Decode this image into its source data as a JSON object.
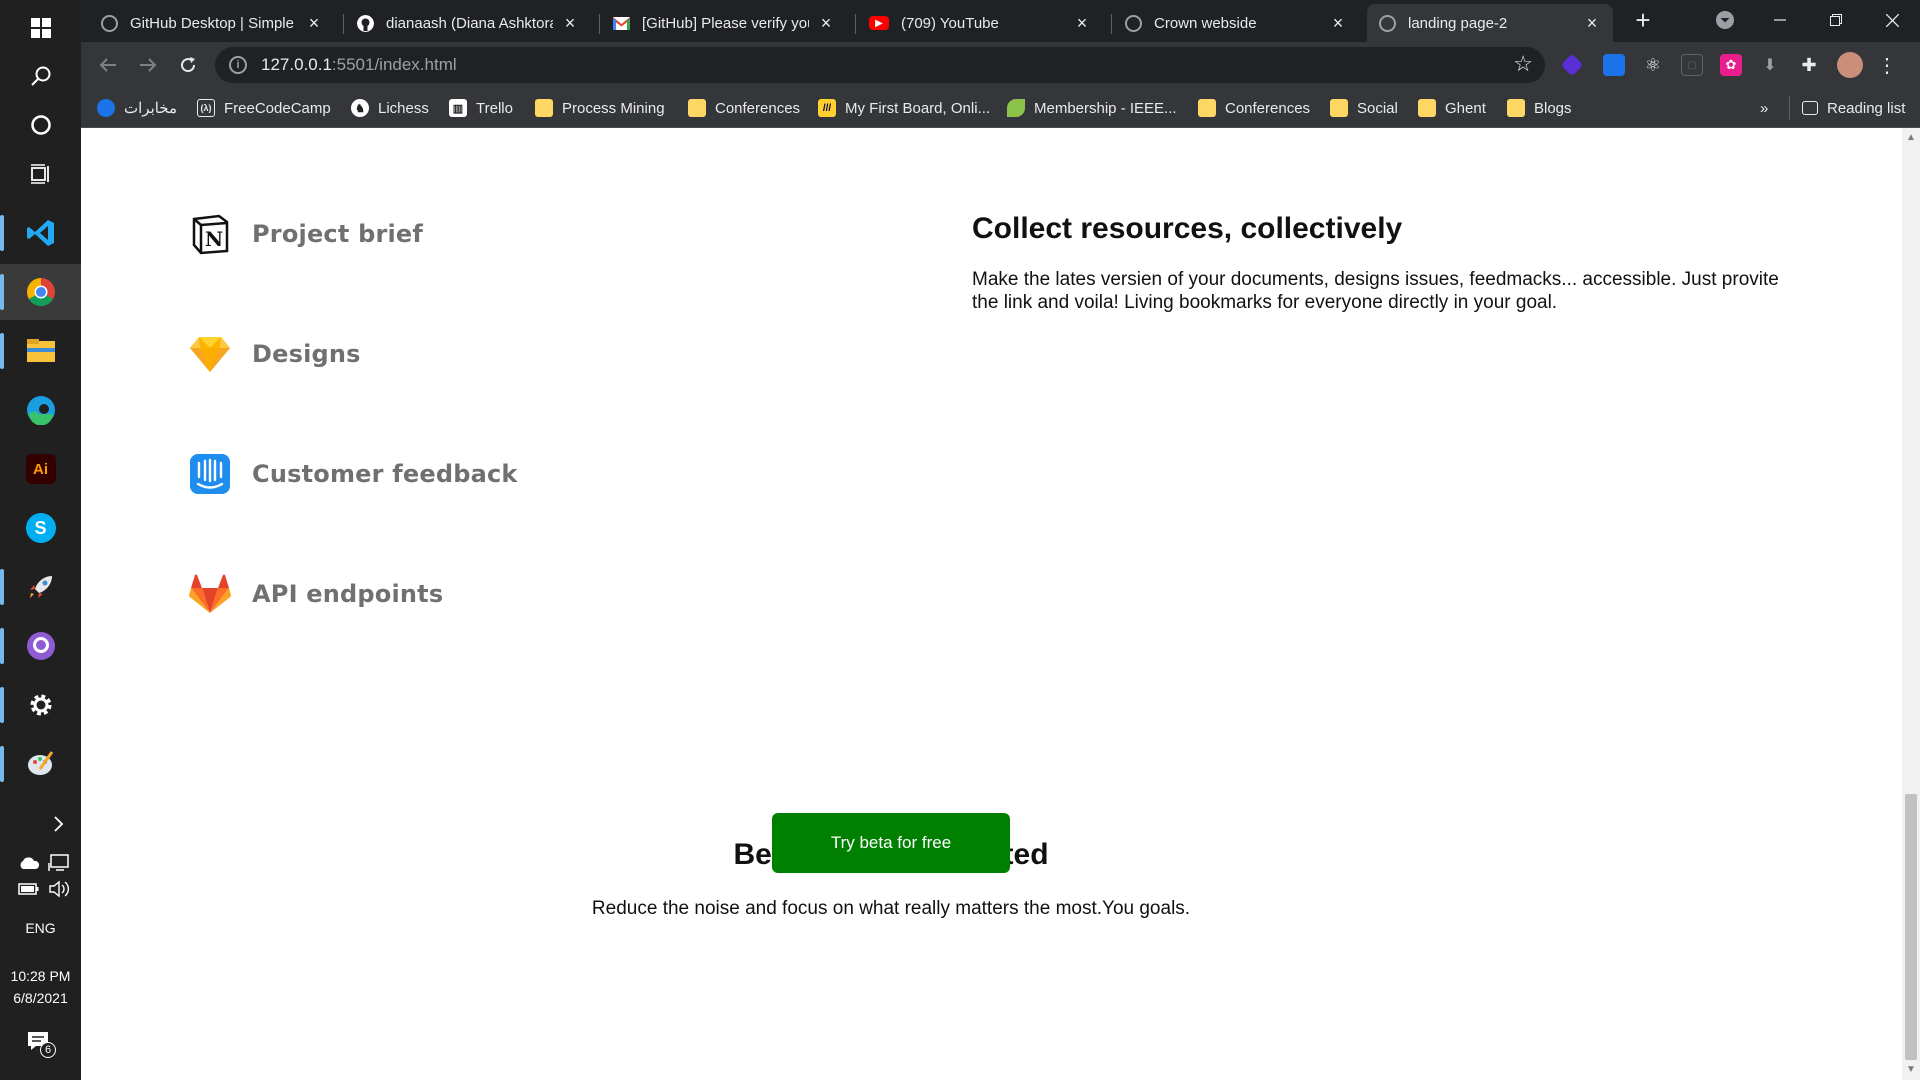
{
  "taskbar": {
    "keyboard_lang": "ENG",
    "time": "10:28 PM",
    "date": "6/8/2021",
    "notification_count": "6",
    "ai_app_label": "Ai",
    "skype_label": "S"
  },
  "browser": {
    "tabs": [
      {
        "title": "GitHub Desktop | Simple c"
      },
      {
        "title": "dianaash (Diana Ashktorab"
      },
      {
        "title": "[GitHub] Please verify you"
      },
      {
        "title": "(709) YouTube"
      },
      {
        "title": "Crown webside"
      },
      {
        "title": "landing page-2"
      }
    ],
    "address": {
      "host": "127.0.0.1",
      "path": ":5501/index.html"
    },
    "bookmarks": [
      {
        "label": "مخابرات"
      },
      {
        "label": "FreeCodeCamp"
      },
      {
        "label": "Lichess"
      },
      {
        "label": "Trello"
      },
      {
        "label": "Process Mining"
      },
      {
        "label": "Conferences"
      },
      {
        "label": "My First Board, Onli..."
      },
      {
        "label": "Membership - IEEE..."
      },
      {
        "label": "Conferences"
      },
      {
        "label": "Social"
      },
      {
        "label": "Ghent"
      },
      {
        "label": "Blogs"
      }
    ],
    "bookmarks_overflow": "»",
    "reading_list": "Reading list"
  },
  "page": {
    "tools": [
      {
        "label": "Project brief",
        "icon": "notion-icon"
      },
      {
        "label": "Designs",
        "icon": "sketch-icon"
      },
      {
        "label": "Customer feedback",
        "icon": "intercom-icon"
      },
      {
        "label": "API endpoints",
        "icon": "gitlab-icon"
      }
    ],
    "feature": {
      "title": "Collect resources, collectively",
      "text": "Make the lates versien of your documents, designs issues, feedmacks... accessible. Just provite the link and voila! Living bookmarks for everyone directly in your goal."
    },
    "cta": {
      "title": "Become goal-oriented",
      "text": "Reduce the noise and focus on what really matters the most.You goals.",
      "button": "Try beta for free"
    }
  },
  "colors": {
    "cta_button": "#008000",
    "tool_label": "#707070",
    "chrome_dark": "#202124",
    "chrome_toolbar": "#35363a",
    "taskbar": "#202020"
  }
}
